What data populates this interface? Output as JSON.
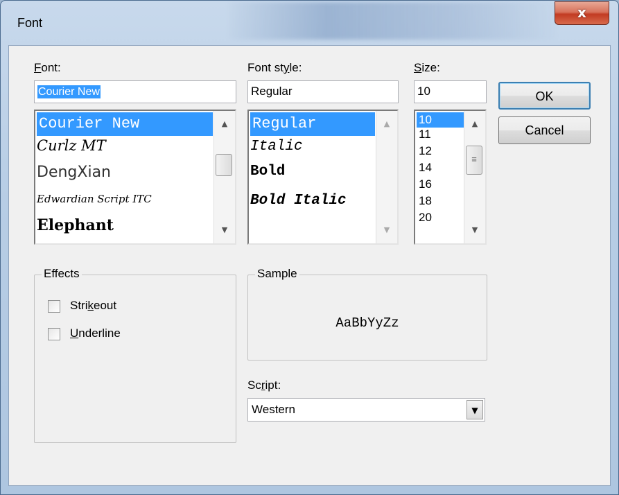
{
  "window": {
    "title": "Font",
    "close_glyph": "x"
  },
  "font": {
    "label": "Font:",
    "value": "Courier New",
    "items": [
      "Courier New",
      "Curlz MT",
      "DengXian",
      "Edwardian Script ITC",
      "Elephant"
    ]
  },
  "style": {
    "label": "Font style:",
    "value": "Regular",
    "items": [
      "Regular",
      "Italic",
      "Bold",
      "Bold Italic"
    ]
  },
  "size": {
    "label": "Size:",
    "value": "10",
    "items": [
      "10",
      "11",
      "12",
      "14",
      "16",
      "18",
      "20"
    ]
  },
  "buttons": {
    "ok": "OK",
    "cancel": "Cancel"
  },
  "effects": {
    "legend": "Effects",
    "strikeout": {
      "label": "Strikeout",
      "checked": false
    },
    "underline": {
      "label": "Underline",
      "checked": false
    }
  },
  "sample": {
    "legend": "Sample",
    "text": "AaBbYyZz"
  },
  "script": {
    "label": "Script:",
    "value": "Western"
  },
  "icons": {
    "scroll_up": "scroll-up-arrow-icon",
    "scroll_down": "scroll-down-arrow-icon",
    "dropdown": "dropdown-arrow-icon",
    "size_thumb_grip": "≡"
  },
  "colors": {
    "selection": "#3399ff",
    "close": "#c23b22"
  }
}
